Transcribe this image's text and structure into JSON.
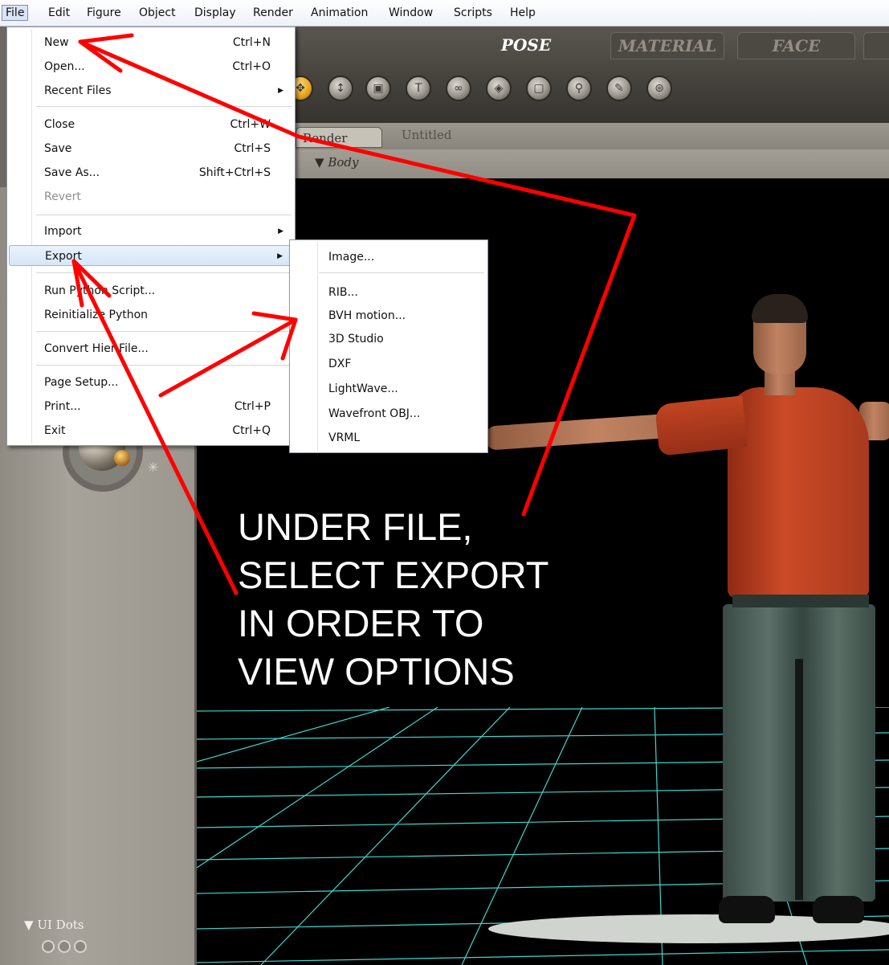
{
  "menubar": {
    "items": [
      "File",
      "Edit",
      "Figure",
      "Object",
      "Display",
      "Render",
      "Animation",
      "Window",
      "Scripts",
      "Help"
    ]
  },
  "room_tabs": [
    "POSE",
    "MATERIAL",
    "FACE"
  ],
  "document": {
    "render_tab": "Render",
    "title": "Untitled",
    "selected_figure_part": "Body"
  },
  "file_menu": {
    "items": [
      {
        "label": "New",
        "shortcut": "Ctrl+N"
      },
      {
        "label": "Open...",
        "shortcut": "Ctrl+O"
      },
      {
        "label": "Recent Files",
        "shortcut": "",
        "submenu": true
      },
      {
        "label": "Close",
        "shortcut": "Ctrl+W"
      },
      {
        "label": "Save",
        "shortcut": "Ctrl+S"
      },
      {
        "label": "Save As...",
        "shortcut": "Shift+Ctrl+S"
      },
      {
        "label": "Revert",
        "shortcut": "",
        "disabled": true
      },
      {
        "label": "Import",
        "shortcut": "",
        "submenu": true
      },
      {
        "label": "Export",
        "shortcut": "",
        "submenu": true,
        "highlighted": true
      },
      {
        "label": "Run Python Script...",
        "shortcut": ""
      },
      {
        "label": "Reinitialize Python",
        "shortcut": ""
      },
      {
        "label": "Convert Hier File...",
        "shortcut": ""
      },
      {
        "label": "Page Setup...",
        "shortcut": ""
      },
      {
        "label": "Print...",
        "shortcut": "Ctrl+P"
      },
      {
        "label": "Exit",
        "shortcut": "Ctrl+Q"
      }
    ]
  },
  "export_menu": {
    "items": [
      "Image...",
      "RIB...",
      "BVH motion...",
      "3D Studio",
      "DXF",
      "LightWave...",
      "Wavefront OBJ...",
      "VRML"
    ]
  },
  "left_panel": {
    "uidots_label": "UI Dots"
  },
  "annotation": {
    "lines": [
      "UNDER FILE,",
      "SELECT EXPORT",
      "IN ORDER TO",
      "VIEW OPTIONS"
    ],
    "arrow_color": "#ff0000"
  },
  "colors": {
    "menu_highlight": "#d6e6f8",
    "shirt": "#cc4a26",
    "grid": "#3fd6cf"
  }
}
